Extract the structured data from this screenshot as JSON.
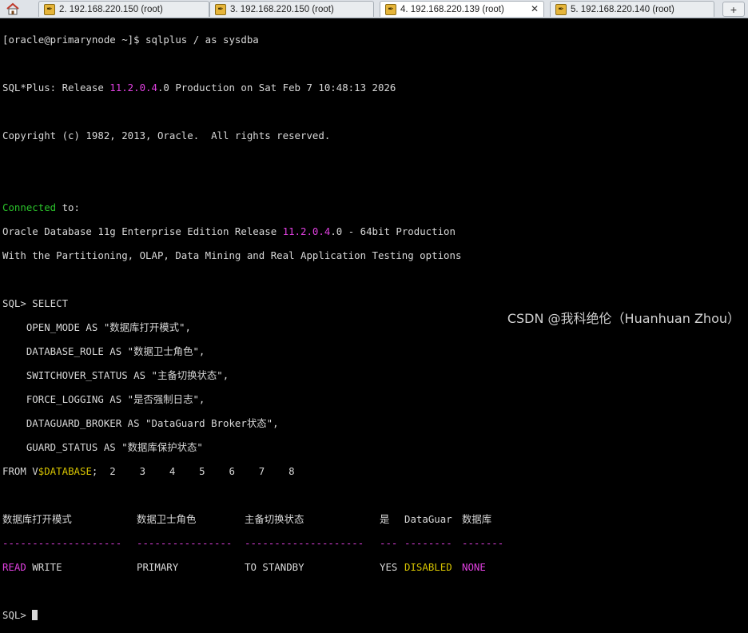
{
  "tabs": [
    {
      "label": "2. 192.168.220.150 (root)",
      "active": false
    },
    {
      "label": "3. 192.168.220.150 (root)",
      "active": false
    },
    {
      "label": "4. 192.168.220.139 (root)",
      "active": true
    },
    {
      "label": "5. 192.168.220.140 (root)",
      "active": false
    }
  ],
  "terminal": {
    "prompt_line": "[oracle@primarynode ~]$ sqlplus / as sysdba",
    "banner_pre": "SQL*Plus: Release ",
    "version": "11.2.0.4",
    "banner_post": ".0 Production on Sat Feb 7 10:48:13 2026",
    "copyright": "Copyright (c) 1982, 2013, Oracle.  All rights reserved.",
    "connected": "Connected",
    "connected_post": " to:",
    "db_pre": "Oracle Database 11g Enterprise Edition Release ",
    "db_post": ".0 - 64bit Production",
    "options": "With the Partitioning, OLAP, Data Mining and Real Application Testing options",
    "sql_lines": [
      "SQL> SELECT",
      "    OPEN_MODE AS \"数据库打开模式\",",
      "    DATABASE_ROLE AS \"数据卫士角色\",",
      "    SWITCHOVER_STATUS AS \"主备切换状态\",",
      "    FORCE_LOGGING AS \"是否强制日志\",",
      "    DATAGUARD_BROKER AS \"DataGuard Broker状态\",",
      "    GUARD_STATUS AS \"数据库保护状态\""
    ],
    "from_pre": "FROM V",
    "from_table": "$DATABASE",
    "from_post": ";  2    3    4    5    6    7    8",
    "headers": [
      "数据库打开模式",
      "数据卫士角色",
      "主备切换状态",
      "是",
      "DataGuar",
      "数据库"
    ],
    "separators": [
      "--------------------",
      "----------------",
      "--------------------",
      "---",
      "--------",
      "-------"
    ],
    "row": {
      "read": "READ",
      "write": " WRITE",
      "role": "PRIMARY",
      "switchover": "TO STANDBY",
      "force": "YES",
      "broker": "DISABLED",
      "guard": "NONE"
    },
    "final_prompt": "SQL> "
  },
  "watermark": "CSDN @我科绝伦（Huanhuan Zhou）"
}
